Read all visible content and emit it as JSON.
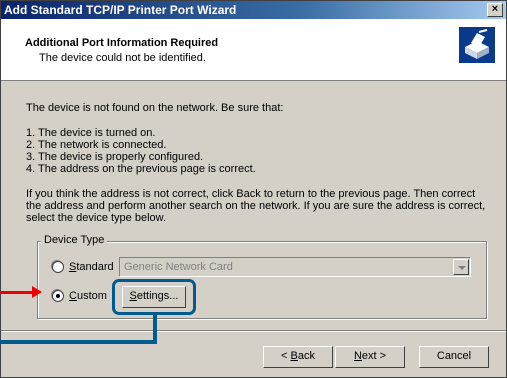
{
  "window": {
    "title": "Add Standard TCP/IP Printer Port Wizard",
    "close_glyph": "×"
  },
  "header": {
    "title": "Additional Port Information Required",
    "subtitle": "The device could not be identified.",
    "icon": "printer-network-icon"
  },
  "body": {
    "intro": "The device is not found on the network.  Be sure that:",
    "items": [
      "1.   The device is turned on.",
      "2.   The network is connected.",
      "3.   The device is properly configured.",
      "4.   The address on the previous page is correct."
    ],
    "paragraph": [
      "If you think the address is not correct, click Back to return to the previous page.  Then correct",
      "the address and perform another search on the network.  If you are sure the address is correct,",
      "select the device type below."
    ]
  },
  "device_type": {
    "label": "Device Type",
    "standard_label_first": "S",
    "standard_label_rest": "tandard",
    "standard_selected": false,
    "standard_value": "Generic Network Card",
    "custom_label_first": "C",
    "custom_label_rest": "ustom",
    "custom_selected": true,
    "settings_first": "S",
    "settings_rest": "ettings..."
  },
  "buttons": {
    "back_prefix": "< ",
    "back_first": "B",
    "back_rest": "ack",
    "next_first": "N",
    "next_rest": "ext >",
    "cancel": "Cancel"
  },
  "colors": {
    "callout": "#005b8f",
    "arrow": "#e00000"
  }
}
